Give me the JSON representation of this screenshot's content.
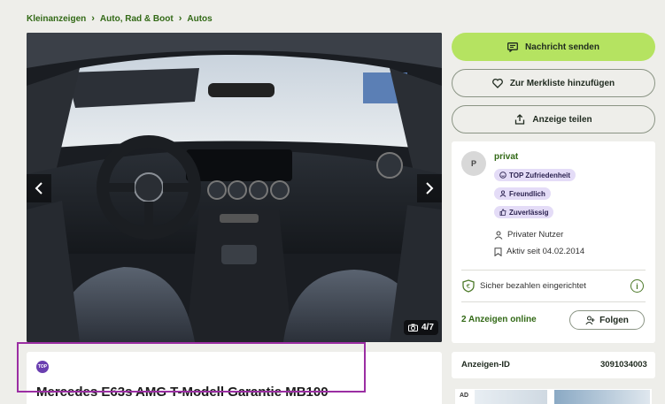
{
  "breadcrumb": {
    "items": [
      "Kleinanzeigen",
      "Auto, Rad & Boot",
      "Autos"
    ]
  },
  "gallery": {
    "counter": "4/7"
  },
  "listing": {
    "badge": "TOP",
    "title": "Mercedes E63s AMG T-Modell Garantie MB100"
  },
  "actions": {
    "message": "Nachricht senden",
    "watchlist": "Zur Merkliste hinzufügen",
    "share": "Anzeige teilen"
  },
  "seller": {
    "avatar_initial": "P",
    "name": "privat",
    "badges": [
      "TOP Zufriedenheit",
      "Freundlich",
      "Zuverlässig"
    ],
    "type": "Privater Nutzer",
    "active_since": "Aktiv seit 04.02.2014",
    "secure_payment": "Sicher bezahlen eingerichtet",
    "online_ads": "2 Anzeigen online",
    "follow": "Folgen"
  },
  "ad_id": {
    "label": "Anzeigen-ID",
    "value": "3091034003"
  },
  "advert": {
    "label": "AD"
  },
  "colors": {
    "accent": "#b5e361",
    "link": "#326916",
    "badge": "#e4dcf7",
    "highlight": "#9b2ea3"
  }
}
